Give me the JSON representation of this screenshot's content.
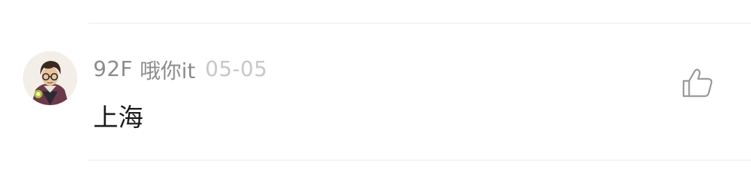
{
  "comment": {
    "floor": "92F",
    "username": "哦你it",
    "date": "05-05",
    "text": "上海"
  },
  "icons": {
    "like": "thumbs-up-icon",
    "avatar": "user-avatar"
  },
  "colors": {
    "meta_text": "#8c8c8c",
    "date_text": "#c7c7c7",
    "body_text": "#1a1a1a",
    "divider": "#ececec",
    "icon_stroke": "#9a9a9a"
  }
}
